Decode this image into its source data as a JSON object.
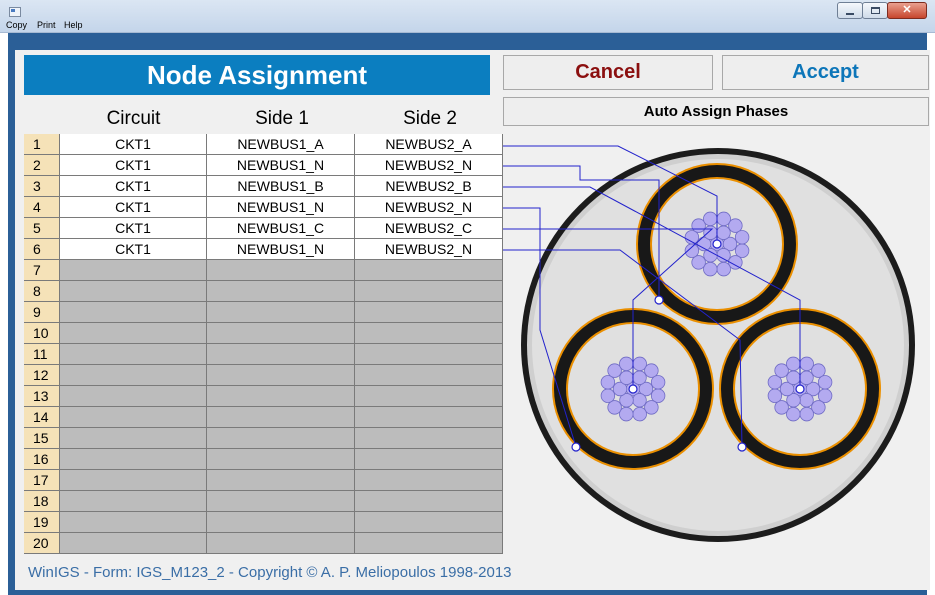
{
  "menu": [
    "Copy",
    "Print",
    "Help"
  ],
  "title": "Node Assignment",
  "buttons": {
    "cancel": "Cancel",
    "accept": "Accept",
    "auto_assign": "Auto Assign Phases"
  },
  "columns": [
    "Circuit",
    "Side 1",
    "Side 2"
  ],
  "rows": [
    {
      "num": "1",
      "circuit": "CKT1",
      "side1": "NEWBUS1_A",
      "side2": "NEWBUS2_A"
    },
    {
      "num": "2",
      "circuit": "CKT1",
      "side1": "NEWBUS1_N",
      "side2": "NEWBUS2_N"
    },
    {
      "num": "3",
      "circuit": "CKT1",
      "side1": "NEWBUS1_B",
      "side2": "NEWBUS2_B"
    },
    {
      "num": "4",
      "circuit": "CKT1",
      "side1": "NEWBUS1_N",
      "side2": "NEWBUS2_N"
    },
    {
      "num": "5",
      "circuit": "CKT1",
      "side1": "NEWBUS1_C",
      "side2": "NEWBUS2_C"
    },
    {
      "num": "6",
      "circuit": "CKT1",
      "side1": "NEWBUS1_N",
      "side2": "NEWBUS2_N"
    },
    {
      "num": "7",
      "circuit": "",
      "side1": "",
      "side2": ""
    },
    {
      "num": "8",
      "circuit": "",
      "side1": "",
      "side2": ""
    },
    {
      "num": "9",
      "circuit": "",
      "side1": "",
      "side2": ""
    },
    {
      "num": "10",
      "circuit": "",
      "side1": "",
      "side2": ""
    },
    {
      "num": "11",
      "circuit": "",
      "side1": "",
      "side2": ""
    },
    {
      "num": "12",
      "circuit": "",
      "side1": "",
      "side2": ""
    },
    {
      "num": "13",
      "circuit": "",
      "side1": "",
      "side2": ""
    },
    {
      "num": "14",
      "circuit": "",
      "side1": "",
      "side2": ""
    },
    {
      "num": "15",
      "circuit": "",
      "side1": "",
      "side2": ""
    },
    {
      "num": "16",
      "circuit": "",
      "side1": "",
      "side2": ""
    },
    {
      "num": "17",
      "circuit": "",
      "side1": "",
      "side2": ""
    },
    {
      "num": "18",
      "circuit": "",
      "side1": "",
      "side2": ""
    },
    {
      "num": "19",
      "circuit": "",
      "side1": "",
      "side2": ""
    },
    {
      "num": "20",
      "circuit": "",
      "side1": "",
      "side2": ""
    }
  ],
  "footer": "WinIGS - Form: IGS_M123_2 - Copyright © A. P. Meliopoulos 1998-2013",
  "colors": {
    "header_bg": "#0b7ec0",
    "cancel_text": "#8b0f0f",
    "accept_text": "#0d76b9",
    "rownum_bg": "#f5e2b8",
    "empty_cell_bg": "#bcbcbc",
    "client_bg": "#2b5f97",
    "conductor": "#b3aaf0",
    "connector_line": "#2222cc"
  },
  "icons": {
    "app": "app-window-icon",
    "minimize": "minimize-icon",
    "maximize": "maximize-icon",
    "close": "close-icon"
  }
}
